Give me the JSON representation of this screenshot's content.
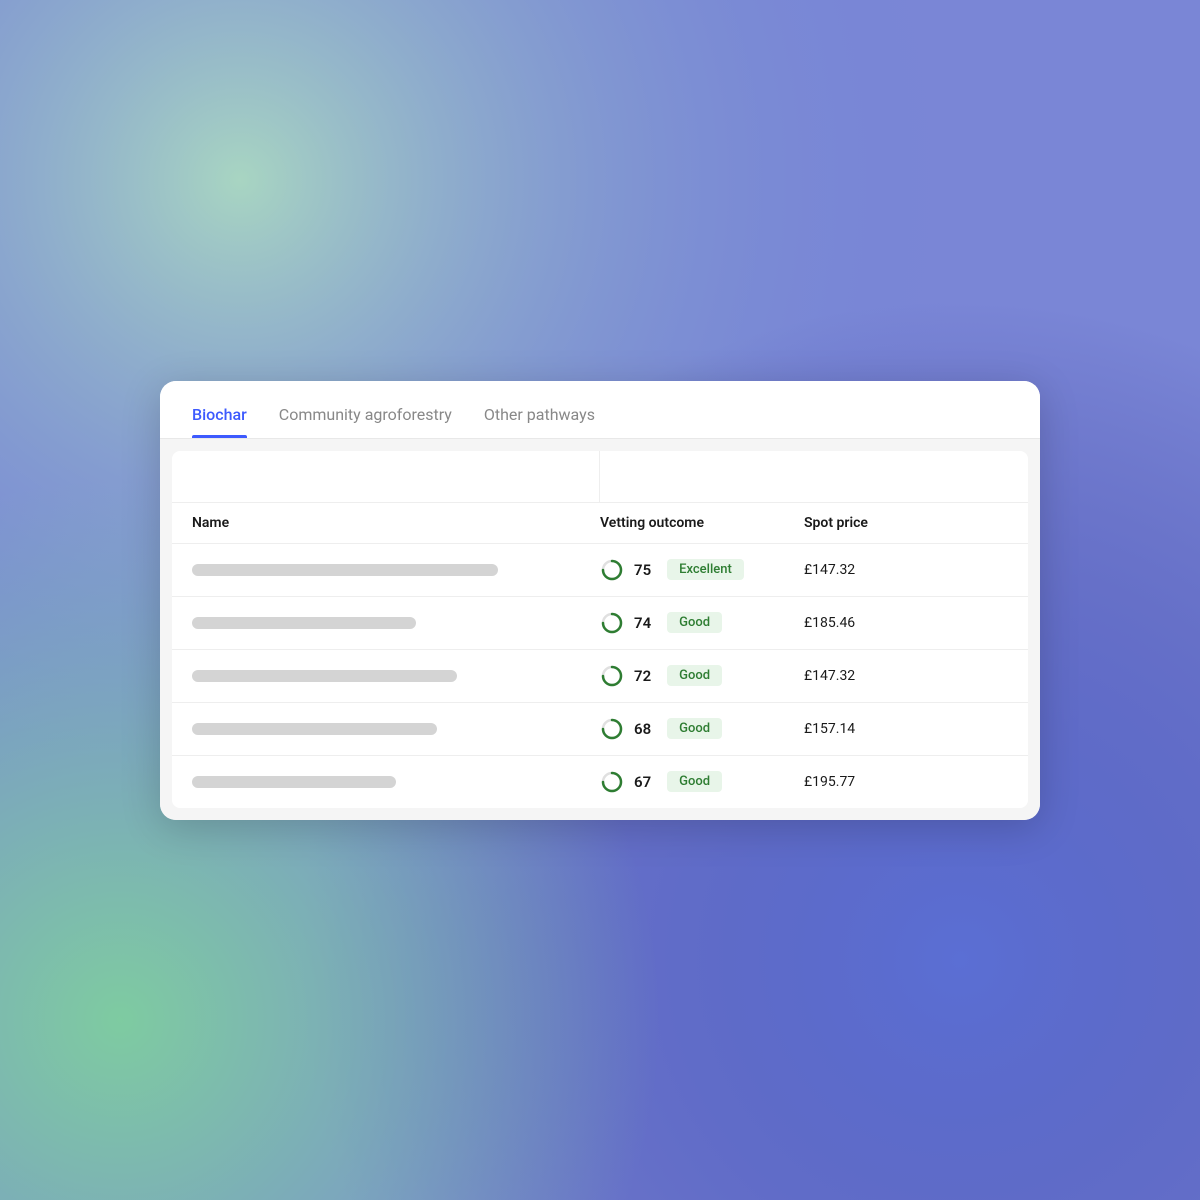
{
  "background": {
    "desc": "colorful noise gradient background"
  },
  "tabs": [
    {
      "id": "biochar",
      "label": "Biochar",
      "active": true
    },
    {
      "id": "community-agroforestry",
      "label": "Community agroforestry",
      "active": false
    },
    {
      "id": "other-pathways",
      "label": "Other pathways",
      "active": false
    }
  ],
  "table": {
    "columns": [
      {
        "id": "name",
        "label": "Name"
      },
      {
        "id": "vetting-outcome",
        "label": "Vetting outcome"
      },
      {
        "id": "spot-price",
        "label": "Spot price"
      }
    ],
    "rows": [
      {
        "id": 1,
        "name_skeleton_width": "75%",
        "score": "75",
        "badge_label": "Excellent",
        "badge_type": "excellent",
        "price": "£147.32"
      },
      {
        "id": 2,
        "name_skeleton_width": "55%",
        "score": "74",
        "badge_label": "Good",
        "badge_type": "good",
        "price": "£185.46"
      },
      {
        "id": 3,
        "name_skeleton_width": "65%",
        "score": "72",
        "badge_label": "Good",
        "badge_type": "good",
        "price": "£147.32"
      },
      {
        "id": 4,
        "name_skeleton_width": "60%",
        "score": "68",
        "badge_label": "Good",
        "badge_type": "good",
        "price": "£157.14"
      },
      {
        "id": 5,
        "name_skeleton_width": "50%",
        "score": "67",
        "badge_label": "Good",
        "badge_type": "good",
        "price": "£195.77"
      }
    ]
  },
  "colors": {
    "active_tab": "#3d5afe",
    "inactive_tab": "#888888",
    "score_circle": "#2e7d32",
    "excellent_bg": "#e8f5e9",
    "good_bg": "#e8f5e9",
    "badge_text": "#2e7d32"
  }
}
